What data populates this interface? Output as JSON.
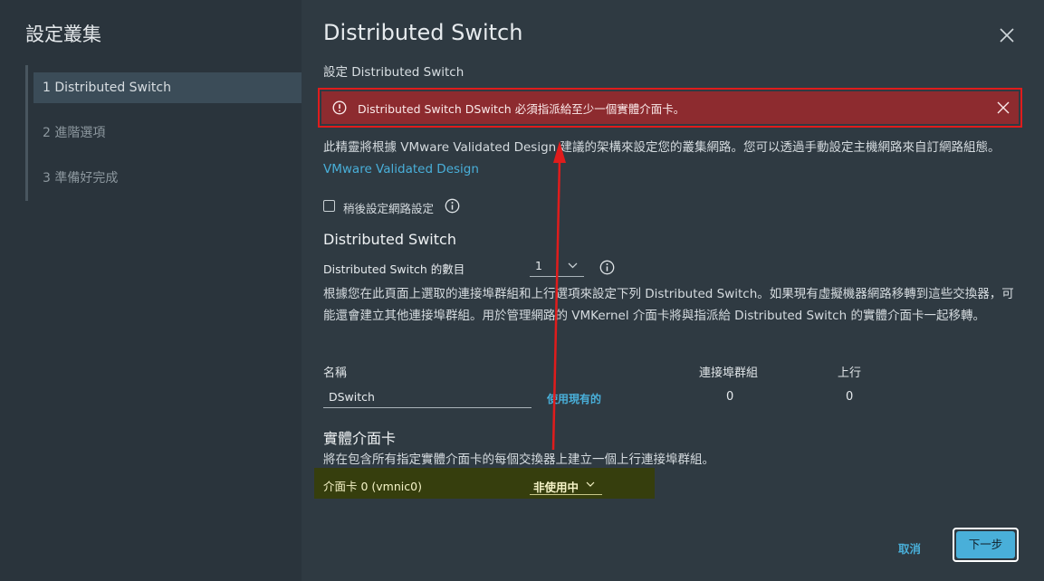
{
  "sidebar": {
    "title": "設定叢集",
    "steps": [
      {
        "label": "1 Distributed Switch"
      },
      {
        "label": "2 進階選項"
      },
      {
        "label": "3 準備好完成"
      }
    ]
  },
  "main": {
    "title": "Distributed Switch",
    "subtitle": "設定 Distributed Switch",
    "alert": "Distributed Switch DSwitch 必須指派給至少一個實體介面卡。",
    "description": "此精靈將根據 VMware Validated Design 建議的架構來設定您的叢集網路。您可以透過手動設定主機網路來自訂網路組態。",
    "description_link": "VMware Validated Design",
    "configure_later_label": "稍後設定網路設定",
    "ds_section_title": "Distributed Switch",
    "ds_count_label": "Distributed Switch 的數目",
    "ds_count_value": "1",
    "ds_paragraph": "根據您在此頁面上選取的連接埠群組和上行選項來設定下列 Distributed Switch。如果現有虛擬機器網路移轉到這些交換器，可能還會建立其他連接埠群組。用於管理網路的 VMKernel 介面卡將與指派給 Distributed Switch 的實體介面卡一起移轉。",
    "table": {
      "headers": {
        "name": "名稱",
        "portgroups": "連接埠群組",
        "uplinks": "上行"
      },
      "row": {
        "name": "DSwitch",
        "use_existing": "使用現有的",
        "portgroups": "0",
        "uplinks": "0"
      }
    },
    "physical_title": "實體介面卡",
    "physical_desc": "將在包含所有指定實體介面卡的每個交換器上建立一個上行連接埠群組。",
    "nic": {
      "label": "介面卡 0 (vmnic0)",
      "value": "非使用中"
    }
  },
  "footer": {
    "cancel": "取消",
    "next": "下一步"
  },
  "colors": {
    "alert_bg": "#8d2b2f",
    "accent": "#49afd9",
    "highlight_row": "#363e0d",
    "annotation": "#e01c1c"
  }
}
